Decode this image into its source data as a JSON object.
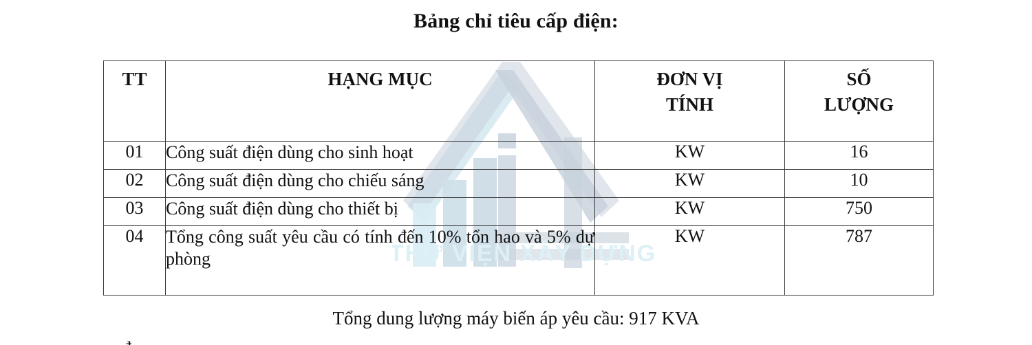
{
  "document": {
    "title": "Bảng chỉ tiêu cấp điện:",
    "footer_note": "Tổng dung lượng máy biến áp yêu cầu: 917 KVA",
    "cut_off_text": "đ"
  },
  "watermark": {
    "text": "THƯ VIỆN XÂY DỰNG",
    "logo_name": "house-bar-chart-logo",
    "color_text": "#dceef4",
    "color_house": "#c8d2dc",
    "color_bars": "#d8e8f0"
  },
  "table": {
    "headers": {
      "tt": "TT",
      "item": "HẠNG MỤC",
      "unit_line1": "ĐƠN VỊ",
      "unit_line2": "TÍNH",
      "qty_line1": "SỐ",
      "qty_line2": "LƯỢNG"
    },
    "rows": [
      {
        "tt": "01",
        "item": "Công suất điện dùng cho sinh hoạt",
        "unit": "KW",
        "qty": "16"
      },
      {
        "tt": "02",
        "item": "Công suất điện dùng cho chiếu sáng",
        "unit": "KW",
        "qty": "10"
      },
      {
        "tt": "03",
        "item": "Công suất điện dùng cho thiết bị",
        "unit": "KW",
        "qty": "750"
      },
      {
        "tt": "04",
        "item": "Tổng công suất yêu cầu có tính đến 10% tổn hao và 5% dự phòng",
        "unit": "KW",
        "qty": "787"
      }
    ]
  },
  "colors": {
    "border": "#3a3a3a",
    "text": "#111111",
    "background": "#ffffff"
  }
}
